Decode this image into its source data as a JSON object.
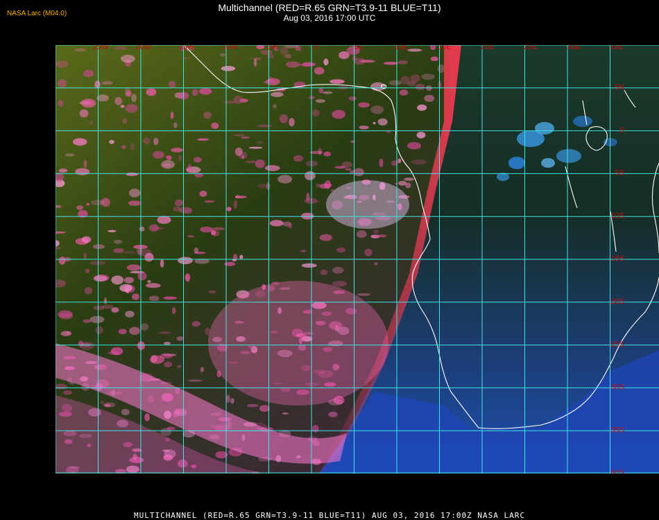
{
  "header": {
    "brand": "NASA Larc (M04.0)",
    "title": "Multichannel (RED=R.65 GRN=T3.9-11 BLUE=T11)",
    "datetime": "Aug 03, 2016 17:00 UTC"
  },
  "map": {
    "longitude_labels": [
      "25W",
      "20W",
      "15W",
      "10W",
      "5W",
      "0",
      "5E",
      "10E",
      "15E",
      "20E",
      "25E",
      "30E",
      "35E"
    ],
    "latitude_labels": [
      "5N",
      "0",
      "5S",
      "10S",
      "15S",
      "20S",
      "25S",
      "30S",
      "35S",
      "40S"
    ],
    "colors": {
      "grid": "#3fe6e6",
      "coast": "#ffffff",
      "label": "#c41010",
      "cloud_pink": "#ff5ab4",
      "land_green": "#1f3a12",
      "ocean_blue": "#1c3f9e",
      "sky_blue": "#2d7cff"
    }
  },
  "footer": {
    "text": "MULTICHANNEL  (RED=R.65 GRN=T3.9-11 BLUE=T11) AUG 03, 2016 17:00Z   NASA LARC"
  }
}
